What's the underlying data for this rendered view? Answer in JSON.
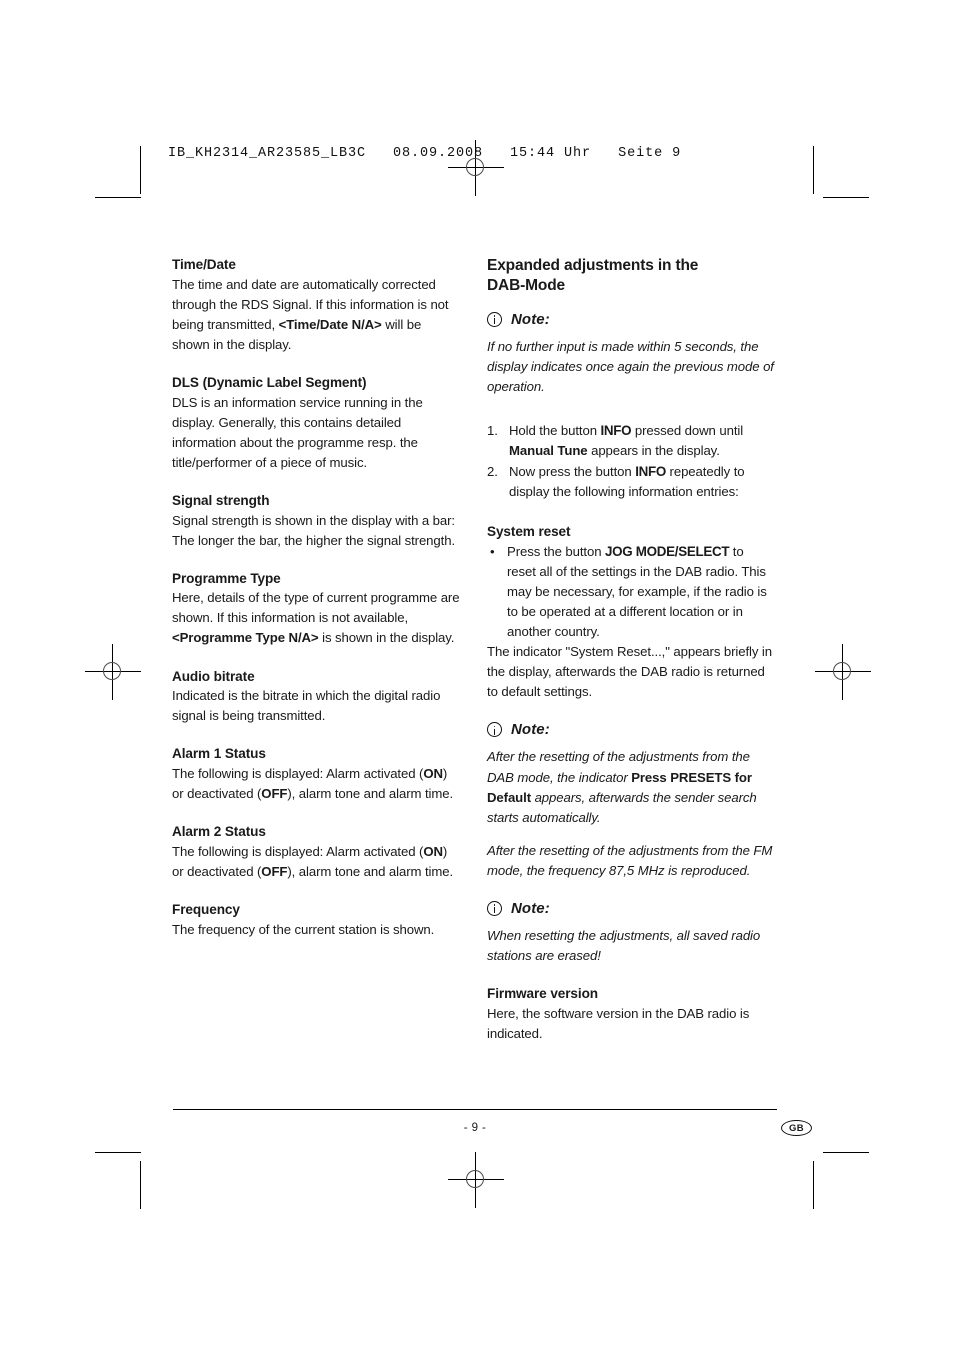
{
  "file_header": "IB_KH2314_AR23585_LB3C   08.09.2008   15:44 Uhr   Seite 9",
  "left_column": {
    "sections": [
      {
        "heading": "Time/Date",
        "body_pre": "The time and date are automatically corrected through the RDS Signal. If this information is not being transmitted, ",
        "body_bold": "<Time/Date N/A>",
        "body_post": " will be shown in the display."
      },
      {
        "heading": "DLS (Dynamic Label Segment)",
        "body": "DLS is an information service running in the display. Generally, this contains detailed information about the programme resp. the title/performer of a piece of music."
      },
      {
        "heading": "Signal strength",
        "body": "Signal strength is shown in the display with a bar: The longer the bar, the higher the signal strength."
      },
      {
        "heading": "Programme Type",
        "body_pre": "Here, details of the type of current programme are shown. If this information is not available, ",
        "body_bold": "<Programme Type N/A>",
        "body_post": " is shown in the display."
      },
      {
        "heading": "Audio bitrate",
        "body": "Indicated is the bitrate in which the digital radio signal is being transmitted."
      },
      {
        "heading": "Alarm 1 Status",
        "body_pre": "The following is displayed: Alarm activated (",
        "bold_1": "ON",
        "body_mid": ") or deactivated (",
        "bold_2": "OFF",
        "body_post": "), alarm tone and alarm time."
      },
      {
        "heading": "Alarm 2 Status",
        "body_pre": "The following is displayed: Alarm activated (",
        "bold_1": "ON",
        "body_mid": ") or deactivated (",
        "bold_2": "OFF",
        "body_post": "), alarm tone and alarm time."
      },
      {
        "heading": "Frequency",
        "body": "The frequency of the current station is shown."
      }
    ]
  },
  "right_column": {
    "title_line_1": "Expanded adjustments in the",
    "title_line_2": "DAB-Mode",
    "note_label": "Note:",
    "note_1_text": "If no further input is made within 5 seconds, the display indicates once again the previous mode of operation.",
    "steps": [
      {
        "num": "1.",
        "pre": "Hold the button ",
        "btn": "INFO",
        "mid": " pressed down until ",
        "bold": "Manual Tune",
        "post": " appears in the display."
      },
      {
        "num": "2.",
        "pre": "Now press the button ",
        "btn": "INFO",
        "post": " repeatedly to display the following information entries:"
      }
    ],
    "system_reset": {
      "heading": "System reset",
      "bullet_symbol": "•",
      "bullet_pre": "Press the button ",
      "bullet_btn": "JOG MODE/SELECT",
      "bullet_post": " to reset all of the settings in the DAB radio. This may be necessary, for example, if the radio is to be operated at a different location or in another country.",
      "trailing": "The indicator \"System Reset...,\" appears briefly in the display, afterwards the DAB radio is returned to default settings."
    },
    "note_2_para_1_pre": "After the resetting of the adjustments from the DAB mode, the indicator ",
    "note_2_para_1_bold": "Press PRESETS for Default",
    "note_2_para_1_post": " appears, afterwards the sender search starts automatically.",
    "note_2_para_2": "After the resetting of the adjustments from the FM mode, the frequency 87,5 MHz is reproduced.",
    "note_3_text": "When resetting the adjustments, all saved radio stations are erased!",
    "firmware": {
      "heading": "Firmware version",
      "body": "Here, the software version in the DAB radio is indicated."
    }
  },
  "footer": {
    "page_number": "- 9 -",
    "language_badge": "GB"
  }
}
